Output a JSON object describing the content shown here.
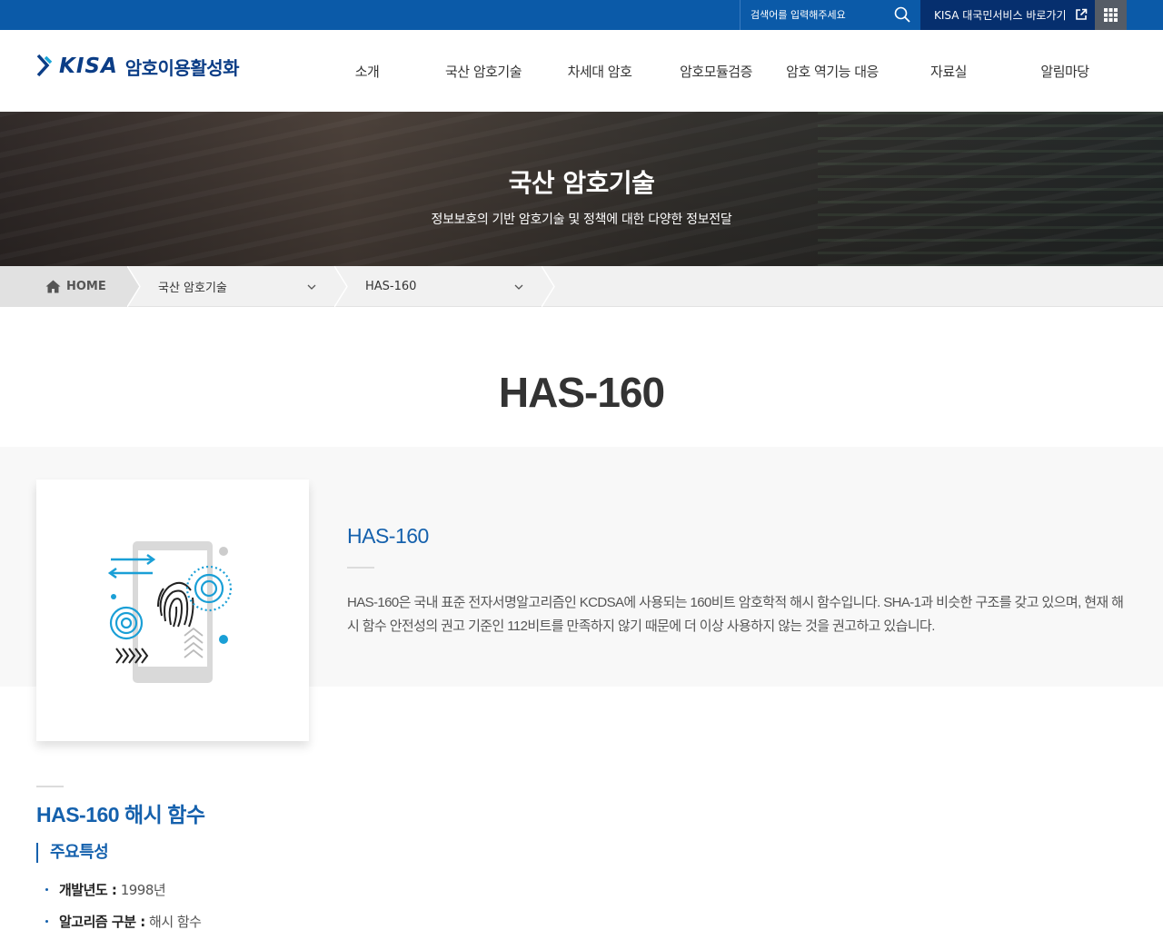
{
  "topbar": {
    "search_placeholder": "검색어를 입력해주세요",
    "kisa_link": "KISA 대국민서비스 바로가기"
  },
  "header": {
    "logo_kisa": "KISA",
    "logo_text": "암호이용활성화",
    "nav": [
      "소개",
      "국산 암호기술",
      "차세대 암호",
      "암호모듈검증",
      "암호 역기능 대응",
      "자료실",
      "알림마당"
    ]
  },
  "hero": {
    "title": "국산 암호기술",
    "subtitle": "정보보호의 기반 암호기술 및 정책에 대한 다양한 정보전달"
  },
  "breadcrumb": {
    "home": "HOME",
    "level1": "국산 암호기술",
    "level2": "HAS-160"
  },
  "page": {
    "title": "HAS-160"
  },
  "intro": {
    "title": "HAS-160",
    "description": "HAS-160은 국내 표준 전자서명알고리즘인 KCDSA에 사용되는 160비트 암호학적 해시 함수입니다. SHA-1과 비슷한 구조를 갖고 있으며, 현재 해시 함수 안전성의 권고 기준인 112비트를 만족하지 않기 때문에 더 이상 사용하지 않는 것을 권고하고 있습니다."
  },
  "section": {
    "title": "HAS-160 해시 함수",
    "subtitle": "주요특성",
    "specs": [
      {
        "label": "개발년도 :",
        "value": " 1998년"
      },
      {
        "label": "알고리즘 구분 :",
        "value": " 해시 함수"
      }
    ]
  },
  "colors": {
    "topbar": "#0b5aa8",
    "kisa_link_bg": "#062f6e",
    "accent": "#1561ad",
    "logo": "#0b3d86"
  }
}
